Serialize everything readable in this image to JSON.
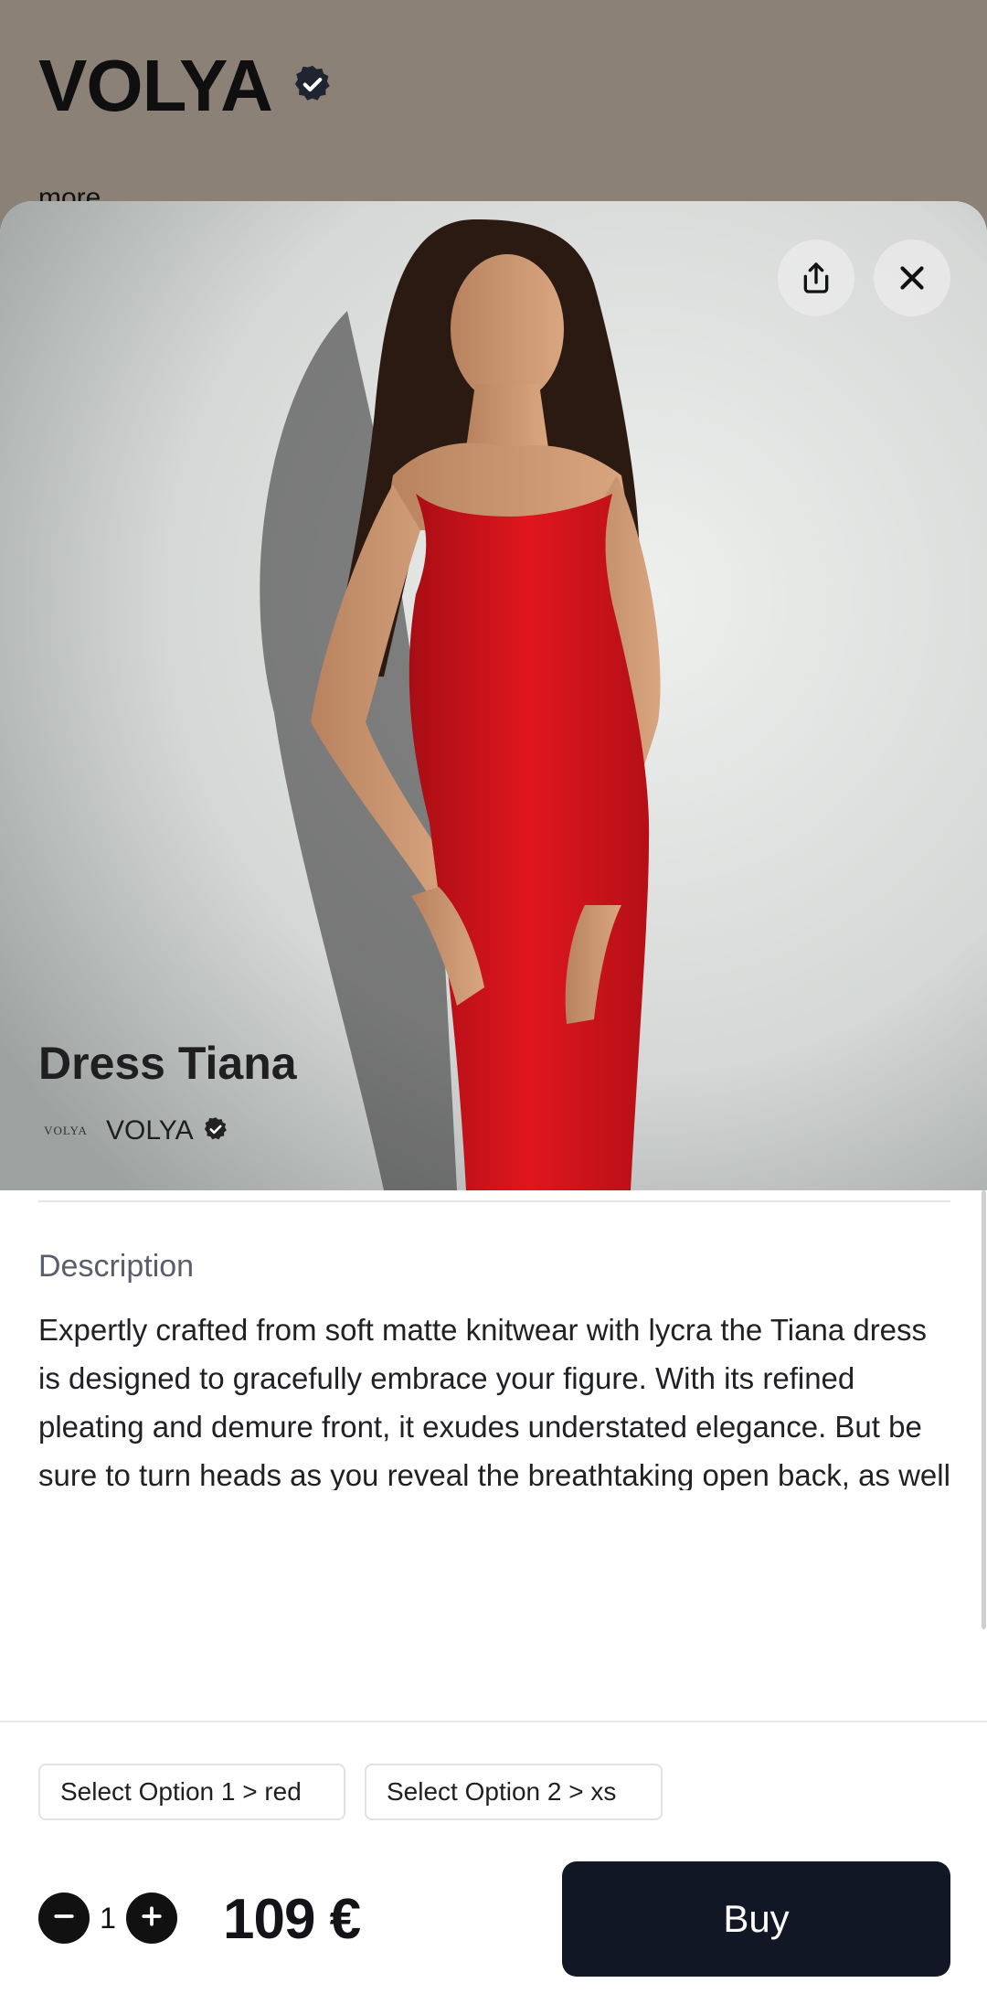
{
  "background": {
    "brand_name": "VOLYA",
    "more_link": "more ..."
  },
  "product": {
    "title": "Dress Tiana",
    "store_logo_text": "VOLYA",
    "store_name": "VOLYA",
    "description_label": "Description",
    "description": "Expertly crafted from soft matte knitwear with lycra the Tiana dress is designed to gracefully embrace your figure. With its refined pleating and demure front, it exudes understated elegance. But be sure to turn heads as you reveal the breathtaking open back, as well as lingering to the..."
  },
  "options": [
    {
      "label": "Select Option 1 > red"
    },
    {
      "label": "Select Option 2 > xs"
    }
  ],
  "cart": {
    "quantity": "1",
    "price": "109 €",
    "buy_label": "Buy"
  },
  "icons": [
    "verified-badge-icon",
    "share-icon",
    "close-icon",
    "minus-icon",
    "plus-icon"
  ],
  "colors": {
    "accent": "#121726",
    "dress": "#d8141b",
    "background_overlay": "#8b8177"
  }
}
